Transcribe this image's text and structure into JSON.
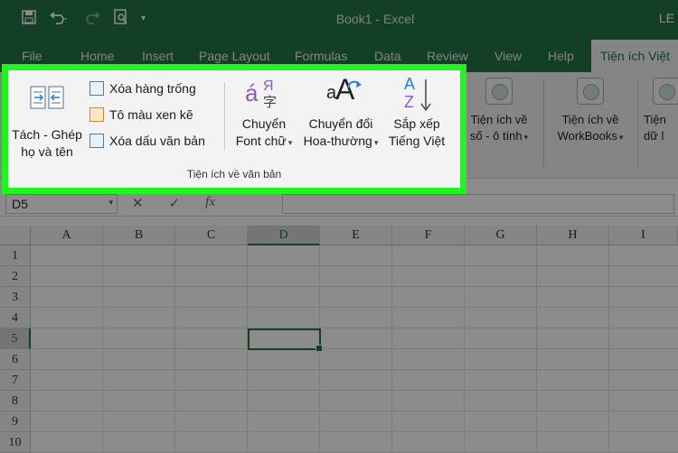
{
  "window": {
    "title": "Book1 - Excel",
    "user": "LE"
  },
  "tabs": [
    {
      "label": "File"
    },
    {
      "label": "Home"
    },
    {
      "label": "Insert"
    },
    {
      "label": "Page Layout"
    },
    {
      "label": "Formulas"
    },
    {
      "label": "Data"
    },
    {
      "label": "Review"
    },
    {
      "label": "View"
    },
    {
      "label": "Help"
    },
    {
      "label": "Tiện ích Việt"
    }
  ],
  "ribbon": {
    "text_group": {
      "label": "Tiện ích về văn bản",
      "split_name": {
        "line1": "Tách - Ghép",
        "line2": "họ và tên"
      },
      "small_buttons": [
        {
          "label": "Xóa hàng trống"
        },
        {
          "label": "Tô màu xen kẽ"
        },
        {
          "label": "Xóa dấu văn bản"
        }
      ],
      "convert_font": {
        "line1": "Chuyển",
        "line2": "Font chữ"
      },
      "convert_case": {
        "line1": "Chuyển đổi",
        "line2": "Hoa-thường"
      },
      "sort_vn": {
        "line1": "Sắp xếp",
        "line2": "Tiếng Việt"
      },
      "icon_glyphs": {
        "font_a": "á",
        "font_b": "Я",
        "font_c": "字",
        "case_a": "a",
        "case_b": "A",
        "sort_a": "A",
        "sort_z": "Z"
      }
    },
    "right_groups": [
      {
        "line1": "Tiện ích về",
        "line2": "số - ô tính"
      },
      {
        "line1": "Tiện ích về",
        "line2": "WorkBooks"
      },
      {
        "line1": "Tiện",
        "line2": "dữ l"
      }
    ]
  },
  "formula_bar": {
    "name_box": "D5",
    "fx": "fx",
    "cancel": "✕",
    "enter": "✓",
    "value": ""
  },
  "grid": {
    "columns": [
      "A",
      "B",
      "C",
      "D",
      "E",
      "F",
      "G",
      "H",
      "I"
    ],
    "rows": [
      "1",
      "2",
      "3",
      "4",
      "5",
      "6",
      "7",
      "8",
      "9",
      "10"
    ],
    "selected_column": "D",
    "selected_row": "5"
  },
  "colors": {
    "excel_green": "#217346",
    "highlight_border": "#21f41e"
  }
}
